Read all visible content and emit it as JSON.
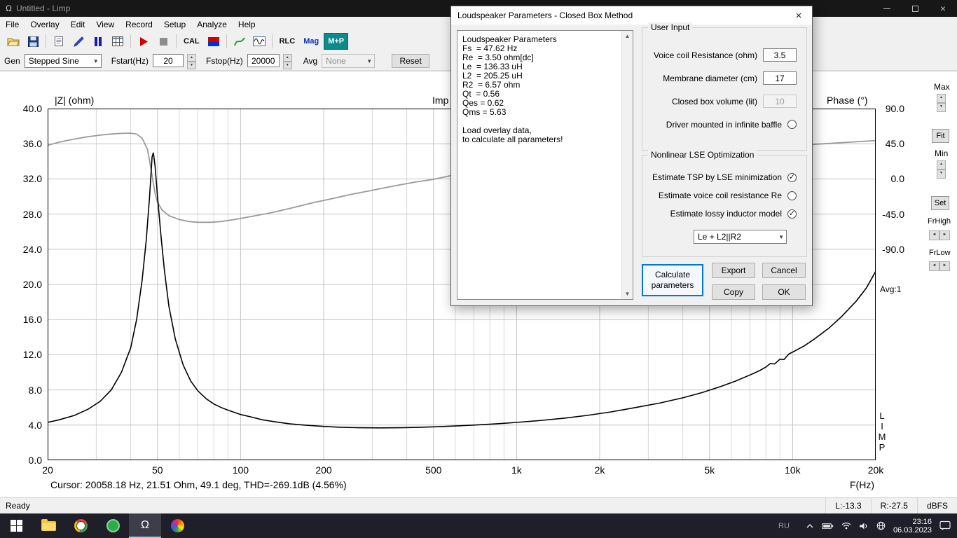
{
  "window": {
    "title": "Untitled - Limp",
    "close_label": "×"
  },
  "menu": {
    "items": [
      "File",
      "Overlay",
      "Edit",
      "View",
      "Record",
      "Setup",
      "Analyze",
      "Help"
    ]
  },
  "toolbar": {
    "items": [
      "open-icon",
      "save-icon",
      "sep",
      "copy-icon",
      "pen-icon",
      "pause-icon",
      "table-icon",
      "sep",
      "record-icon",
      "stop-icon",
      "sep",
      "cal-button",
      "calibration-colors-icon",
      "sep",
      "overlay-icon",
      "generator-icon",
      "sep",
      "rlc-button",
      "mag-button",
      "mp-button"
    ],
    "labels": {
      "cal-button": "CAL",
      "rlc-button": "RLC",
      "mag-button": "Mag",
      "mp-button": "M+P"
    }
  },
  "genbar": {
    "gen_label": "Gen",
    "gen_value": "Stepped Sine",
    "fstart_label": "Fstart(Hz)",
    "fstart_value": "20",
    "fstop_label": "Fstop(Hz)",
    "fstop_value": "20000",
    "avg_label": "Avg",
    "avg_value": "None",
    "reset_label": "Reset"
  },
  "chart": {
    "left_axis_title": "|Z| (ohm)",
    "center_title": "Imp",
    "right_axis_title": "Phase (°)",
    "xlabel": "F(Hz)",
    "cursor_text": "Cursor: 20058.18 Hz, 21.51 Ohm, 49.1 deg, THD=-269.1dB (4.56%)"
  },
  "chart_data": {
    "type": "line",
    "title": "Imp",
    "xlabel": "F(Hz)",
    "x_scale": "log",
    "x_range": [
      20,
      20000
    ],
    "x_ticks": [
      [
        20,
        "20"
      ],
      [
        50,
        "50"
      ],
      [
        100,
        "100"
      ],
      [
        200,
        "200"
      ],
      [
        500,
        "500"
      ],
      [
        1000,
        "1k"
      ],
      [
        2000,
        "2k"
      ],
      [
        5000,
        "5k"
      ],
      [
        10000,
        "10k"
      ],
      [
        20000,
        "20k"
      ]
    ],
    "x_minor": [
      30,
      40,
      60,
      70,
      80,
      90,
      300,
      400,
      600,
      700,
      800,
      900,
      3000,
      4000,
      6000,
      7000,
      8000,
      9000
    ],
    "y_left": {
      "label": "|Z| (ohm)",
      "range": [
        0,
        40
      ],
      "ticks": [
        "40.0",
        "36.0",
        "32.0",
        "28.0",
        "24.0",
        "20.0",
        "16.0",
        "12.0",
        "8.0",
        "4.0",
        "0.0"
      ]
    },
    "y_right": {
      "label": "Phase (°)",
      "ticks": [
        "90.0",
        "45.0",
        "0.0",
        "-45.0",
        "-90.0"
      ],
      "deg_per_div": 45
    },
    "series": [
      {
        "name": "phase",
        "color": "#9a9a9a",
        "axis": "right",
        "points": [
          [
            20,
            43
          ],
          [
            22,
            47
          ],
          [
            25,
            51
          ],
          [
            28,
            54
          ],
          [
            31,
            56
          ],
          [
            34,
            57.5
          ],
          [
            37,
            58.3
          ],
          [
            40,
            58.5
          ],
          [
            42,
            57.5
          ],
          [
            44,
            52
          ],
          [
            46,
            38
          ],
          [
            47,
            20
          ],
          [
            48,
            0
          ],
          [
            49,
            -18
          ],
          [
            50,
            -30
          ],
          [
            52,
            -40
          ],
          [
            55,
            -47
          ],
          [
            60,
            -52
          ],
          [
            65,
            -54.5
          ],
          [
            70,
            -55.5
          ],
          [
            78,
            -55.5
          ],
          [
            85,
            -54.5
          ],
          [
            95,
            -52
          ],
          [
            110,
            -48
          ],
          [
            130,
            -43
          ],
          [
            150,
            -38
          ],
          [
            180,
            -31
          ],
          [
            210,
            -26
          ],
          [
            250,
            -20
          ],
          [
            300,
            -14.5
          ],
          [
            360,
            -9
          ],
          [
            430,
            -4
          ],
          [
            500,
            -0.5
          ],
          [
            600,
            5.5
          ],
          [
            700,
            8
          ],
          [
            850,
            11
          ],
          [
            1000,
            13
          ],
          [
            1300,
            17
          ],
          [
            1700,
            21
          ],
          [
            2200,
            24.5
          ],
          [
            3000,
            29
          ],
          [
            4000,
            32.5
          ],
          [
            5000,
            35
          ],
          [
            6500,
            38
          ],
          [
            8000,
            40
          ],
          [
            10000,
            42.5
          ],
          [
            13000,
            45
          ],
          [
            16000,
            47
          ],
          [
            20000,
            49
          ]
        ]
      },
      {
        "name": "impedance",
        "color": "#000000",
        "axis": "left",
        "points": [
          [
            20,
            4.3
          ],
          [
            22,
            4.6
          ],
          [
            25,
            5.1
          ],
          [
            28,
            5.8
          ],
          [
            31,
            6.7
          ],
          [
            34,
            8.0
          ],
          [
            37,
            10.0
          ],
          [
            40,
            12.8
          ],
          [
            42,
            16.0
          ],
          [
            44,
            20.5
          ],
          [
            45.5,
            25.0
          ],
          [
            46.8,
            30.0
          ],
          [
            47.8,
            34.5
          ],
          [
            48.3,
            35.0
          ],
          [
            49,
            33.5
          ],
          [
            50,
            30.0
          ],
          [
            51.5,
            25.5
          ],
          [
            53,
            21.5
          ],
          [
            55,
            17.5
          ],
          [
            58,
            13.8
          ],
          [
            62,
            10.8
          ],
          [
            66,
            9.0
          ],
          [
            70,
            7.9
          ],
          [
            75,
            7.0
          ],
          [
            80,
            6.4
          ],
          [
            85,
            6.0
          ],
          [
            90,
            5.7
          ],
          [
            100,
            5.2
          ],
          [
            110,
            4.9
          ],
          [
            120,
            4.6
          ],
          [
            135,
            4.35
          ],
          [
            150,
            4.15
          ],
          [
            170,
            4.0
          ],
          [
            200,
            3.85
          ],
          [
            230,
            3.75
          ],
          [
            270,
            3.7
          ],
          [
            320,
            3.68
          ],
          [
            380,
            3.7
          ],
          [
            450,
            3.75
          ],
          [
            500,
            3.8
          ],
          [
            600,
            3.9
          ],
          [
            700,
            4.0
          ],
          [
            850,
            4.15
          ],
          [
            1000,
            4.3
          ],
          [
            1200,
            4.5
          ],
          [
            1500,
            4.8
          ],
          [
            1800,
            5.1
          ],
          [
            2200,
            5.5
          ],
          [
            2700,
            6.0
          ],
          [
            3300,
            6.5
          ],
          [
            4000,
            7.1
          ],
          [
            4700,
            7.7
          ],
          [
            5500,
            8.4
          ],
          [
            6200,
            9.0
          ],
          [
            7000,
            9.7
          ],
          [
            7600,
            10.2
          ],
          [
            8000,
            10.6
          ],
          [
            8300,
            11.0
          ],
          [
            8600,
            10.95
          ],
          [
            9000,
            11.5
          ],
          [
            9300,
            11.45
          ],
          [
            9700,
            12.1
          ],
          [
            10000,
            12.3
          ],
          [
            11000,
            13.0
          ],
          [
            12000,
            13.8
          ],
          [
            13500,
            15.0
          ],
          [
            15000,
            16.3
          ],
          [
            17000,
            18.1
          ],
          [
            18500,
            19.6
          ],
          [
            20000,
            21.5
          ]
        ]
      }
    ]
  },
  "right_panel": {
    "max": "Max",
    "fit": "Fit",
    "min": "Min",
    "set": "Set",
    "fr_high": "FrHigh",
    "fr_low": "FrLow",
    "avg": "Avg:1",
    "limp_vertical": "LIMP"
  },
  "statusbar": {
    "ready": "Ready",
    "left_level": "L:-13.3",
    "right_level": "R:-27.5",
    "units": "dBFS"
  },
  "taskbar": {
    "lang": "RU",
    "time": "23:16",
    "date": "06.03.2023",
    "app_icons": [
      "start-button",
      "file-explorer-icon",
      "chrome-icon",
      "green-app-icon",
      "limp-app-icon",
      "photos-app-icon"
    ],
    "tray_icons": [
      "tray-expand-icon",
      "battery-icon",
      "wifi-icon",
      "volume-icon",
      "network-globe-icon",
      "taskbar-clock",
      "notification-icon"
    ]
  },
  "dialog": {
    "title": "Loudspeaker Parameters - Closed Box Method",
    "close_label": "×",
    "results": [
      "Loudspeaker Parameters",
      "Fs  = 47.62 Hz",
      "Re  = 3.50 ohm[dc]",
      "Le  = 136.33 uH",
      "L2  = 205.25 uH",
      "R2  = 6.57 ohm",
      "Qt  = 0.56",
      "Qes = 0.62",
      "Qms = 5.63",
      "",
      "Load overlay data,",
      "to calculate all parameters!"
    ],
    "user_input": {
      "group_label": "User Input",
      "rows": [
        {
          "label": "Voice coil Resistance (ohm)",
          "type": "input",
          "value": "3.5",
          "enabled": true
        },
        {
          "label": "Membrane diameter (cm)",
          "type": "input",
          "value": "17",
          "enabled": true
        },
        {
          "label": "Closed box volume (lit)",
          "type": "input",
          "value": "10",
          "enabled": false
        },
        {
          "label": "Driver mounted in infinite baffle",
          "type": "checkbox",
          "checked": false
        }
      ]
    },
    "nlse": {
      "group_label": "Nonlinear LSE Optimization",
      "rows": [
        {
          "label": "Estimate TSP by LSE minimization",
          "checked": true
        },
        {
          "label": "Estimate voice coil resistance Re",
          "checked": false
        },
        {
          "label": "Estimate lossy inductor model",
          "checked": true
        }
      ],
      "model_value": "Le + L2||R2"
    },
    "buttons": {
      "calculate": "Calculate parameters",
      "export": "Export",
      "cancel": "Cancel",
      "copy": "Copy",
      "ok": "OK"
    }
  },
  "colors": {
    "focus_blue": "#0078d7",
    "mp_teal": "#0e8a8a",
    "grid": "#c4c4c4",
    "phase_curve": "#9a9a9a",
    "impedance_curve": "#000000"
  }
}
